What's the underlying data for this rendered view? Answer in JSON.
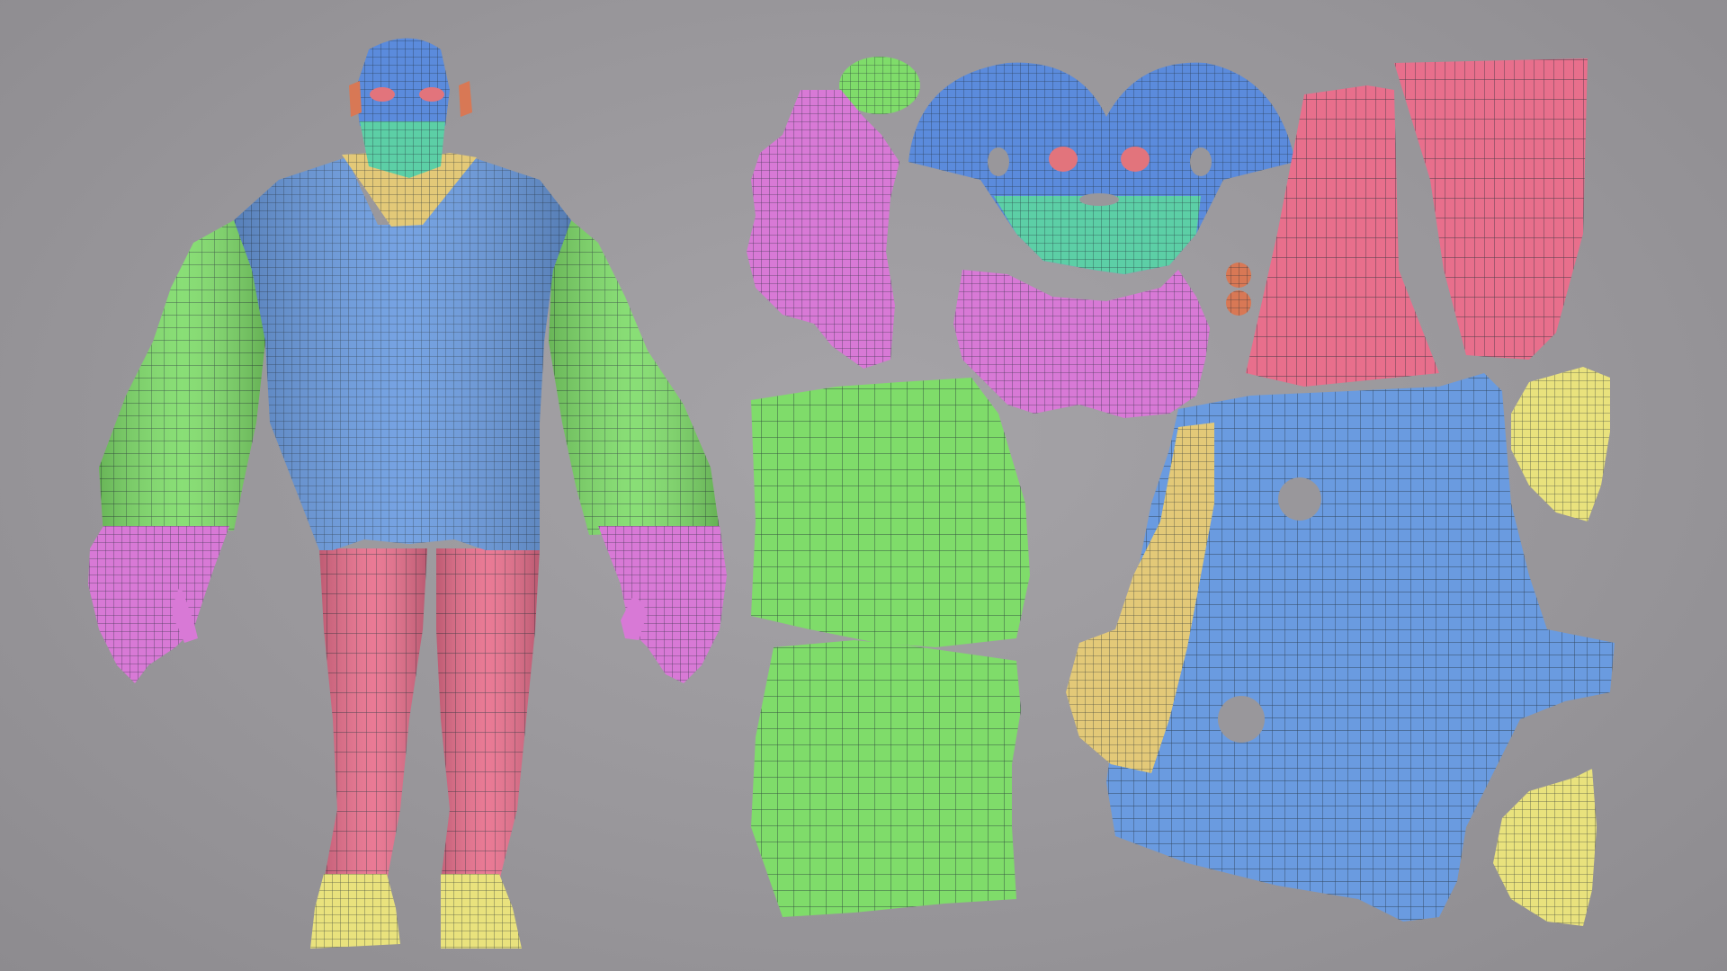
{
  "scene": {
    "subject": "uv-layout-sheet",
    "colors": {
      "head": "#5b8bdc",
      "head_text": "",
      "face_lower": "#5ccfa6",
      "torso": "#6a9be0",
      "collar": "#e3c978",
      "arms": "#7fdc6a",
      "hands": "#d879d6",
      "legs": "#e86f8c",
      "feet": "#e9e27d",
      "eyes": "#e2747c",
      "ears": "#d87855",
      "wire": "#1e2a33"
    }
  }
}
